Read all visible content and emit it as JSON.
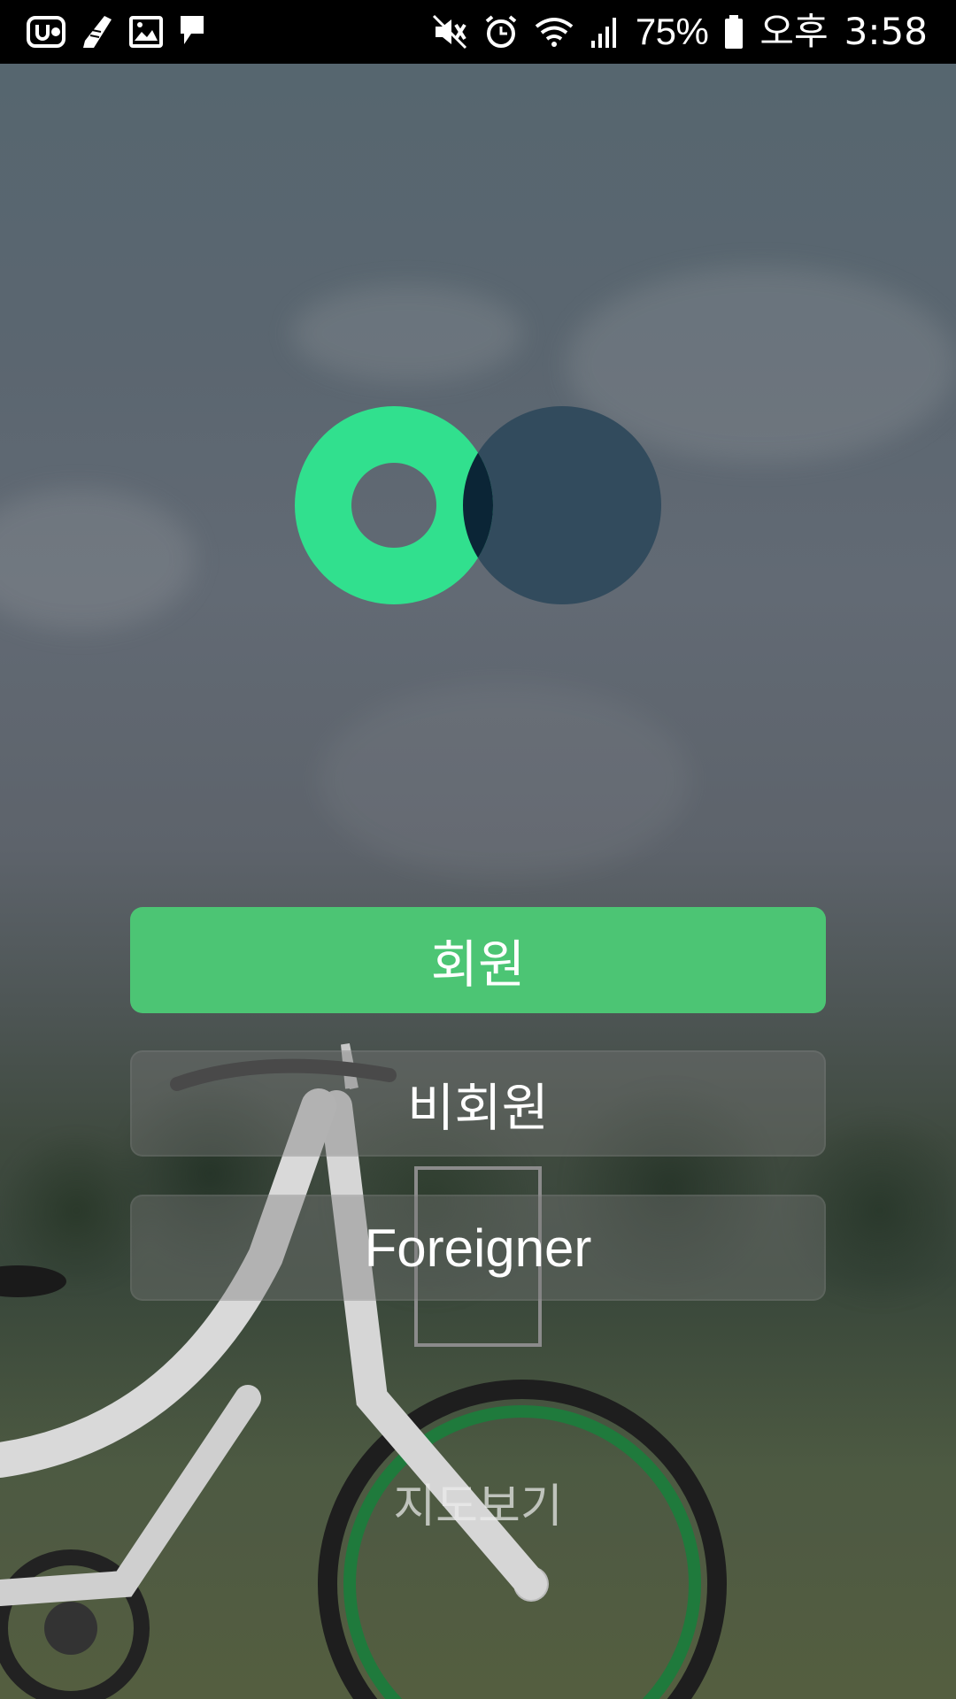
{
  "status_bar": {
    "left_icons": [
      "u-plus-icon",
      "running-shoe-icon",
      "image-icon",
      "message-icon"
    ],
    "right_icons": [
      "mute-icon",
      "alarm-icon",
      "wifi-icon",
      "signal-icon"
    ],
    "battery_percent": "75%",
    "ampm": "오후",
    "time": "3:58"
  },
  "logo": {
    "name": "logo-two-circles",
    "colors": {
      "green": "#31e08e",
      "navy": "#324b5d",
      "overlap": "#0b2536"
    }
  },
  "buttons": {
    "member_label": "회원",
    "guest_label": "비회원",
    "foreigner_label": "Foreigner",
    "map_link_label": "지도보기"
  },
  "colors": {
    "member_button": "#4cc574",
    "secondary_button": "rgba(120,120,120,0.40)"
  }
}
